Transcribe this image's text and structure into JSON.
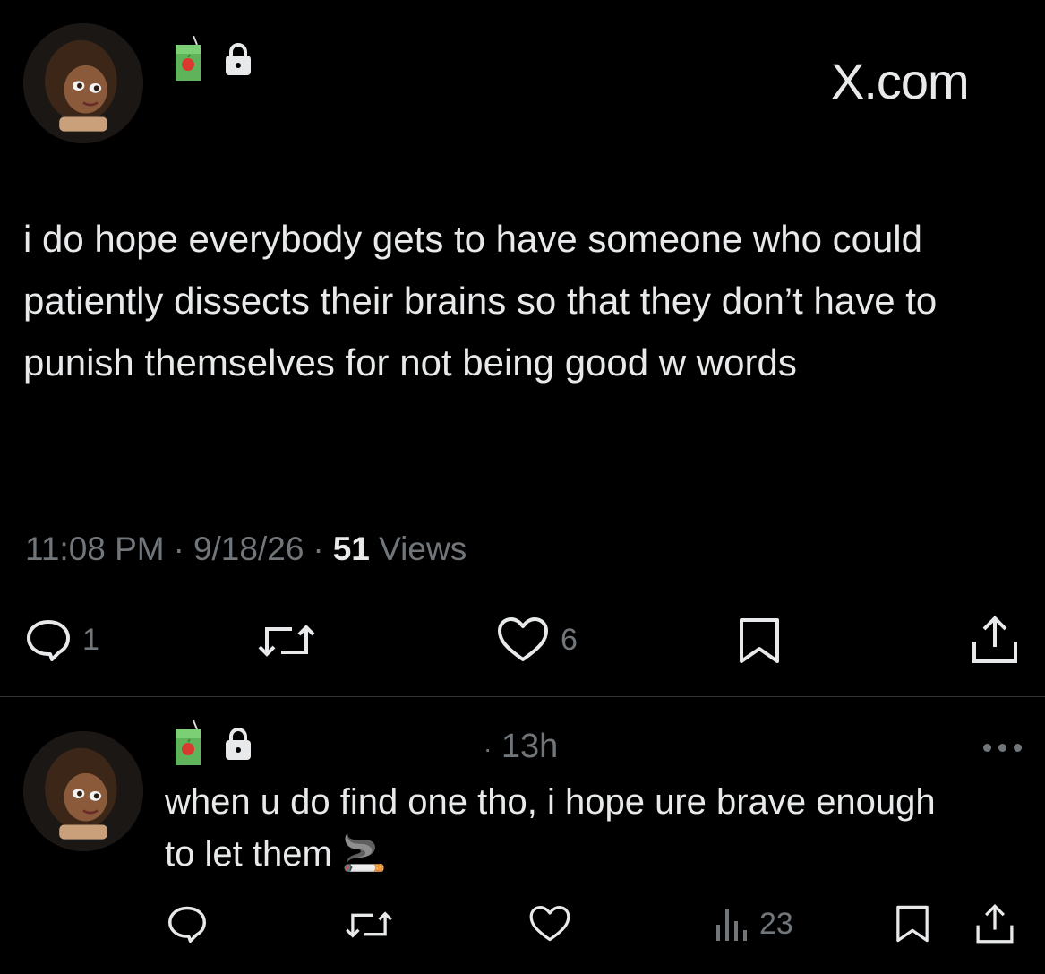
{
  "main_tweet": {
    "avatar_icon": "avatar-image",
    "badges": [
      "juice-box-icon",
      "lock-icon"
    ],
    "site_label": "X.com",
    "text": "i do hope everybody gets to have someone who could patiently dissects their brains so that they don’t have to punish themselves for not being good w words",
    "time": "11:08 PM",
    "sep1": "·",
    "date": "9/18/26",
    "sep2": "·",
    "views_count": "51",
    "views_label": "Views",
    "actions": {
      "reply_count": "1",
      "retweet_count": "",
      "like_count": "6"
    }
  },
  "reply_tweet": {
    "avatar_icon": "avatar-image",
    "badges": [
      "juice-box-icon",
      "lock-icon"
    ],
    "time": "13h",
    "text": "when u do find one tho, i hope ure brave enough to let them 🚬",
    "actions": {
      "views_count": "23"
    }
  },
  "colors": {
    "background": "#000000",
    "text": "#e7e9ea",
    "muted": "#71767b",
    "divider": "#2f3336"
  }
}
